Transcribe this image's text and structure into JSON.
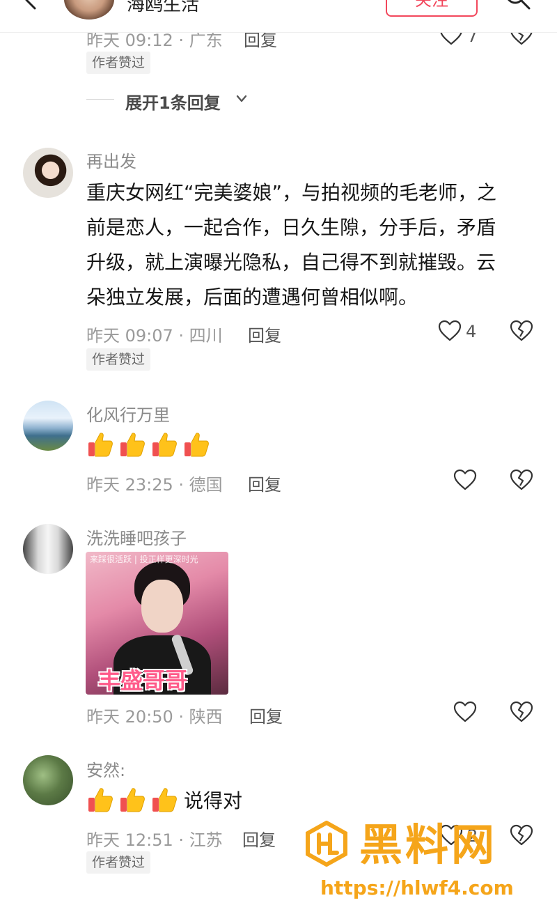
{
  "header": {
    "author_name": "海鸥生活",
    "follow_label": "关注"
  },
  "comments": [
    {
      "meta": "昨天 09:12 · 广东",
      "reply_label": "回复",
      "like_count": "7",
      "badge": "作者赞过",
      "expand_label": "展开1条回复"
    },
    {
      "username": "再出发",
      "text_lines": [
        "重庆女网红“完美婆娘”，与拍视频的毛老师，之",
        "前是恋人，一起合作，日久生隙，分手后，矛盾",
        "升级，就上演曝光隐私，自己得不到就摧毁。云",
        "朵独立发展，后面的遭遇何曾相似啊。"
      ],
      "meta": "昨天 09:07 · 四川",
      "reply_label": "回复",
      "like_count": "4",
      "badge": "作者赞过"
    },
    {
      "username": "化风行万里",
      "thumbs_count": 4,
      "meta": "昨天 23:25 · 德国",
      "reply_label": "回复"
    },
    {
      "username": "洗洗睡吧孩子",
      "sticker_top_text": "来踩很活跃 | 投正样更深时光",
      "sticker_caption": "丰盛哥哥",
      "meta": "昨天 20:50 · 陕西",
      "reply_label": "回复"
    },
    {
      "username": "安然:",
      "thumbs_count": 3,
      "text": "说得对",
      "meta": "昨天 12:51 · 江苏",
      "reply_label": "回复",
      "like_count": "2",
      "badge": "作者赞过"
    }
  ],
  "watermark": {
    "brand": "黑料网",
    "url": "https://hlwf4.com"
  },
  "icons": {
    "like": "heart-outline-icon",
    "dislike": "broken-heart-icon",
    "thumb": "thumbs-up-emoji"
  },
  "colors": {
    "accent": "#f2475c",
    "watermark": "#f5a51a",
    "meta": "#9a9a9a"
  }
}
